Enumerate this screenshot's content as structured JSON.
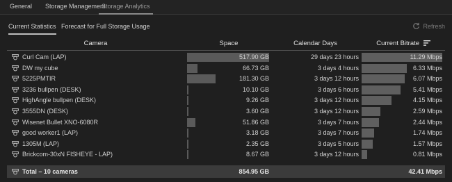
{
  "top_tabs": [
    "General",
    "Storage Management",
    "Storage Analytics"
  ],
  "sub_tabs": [
    "Current Statistics",
    "Forecast for Full Storage Usage"
  ],
  "refresh_label": "Refresh",
  "columns": {
    "camera": "Camera",
    "space": "Space",
    "days": "Calendar Days",
    "bitrate": "Current Bitrate"
  },
  "rows": [
    {
      "name": "Curl Cam (LAP)",
      "space": "517.90 GB",
      "space_fraction": 1.0,
      "days": "29 days 23 hours",
      "bitrate": "11.29 Mbps",
      "bitrate_fraction": 1.0
    },
    {
      "name": "DW my cube",
      "space": "66.73 GB",
      "space_fraction": 0.129,
      "days": "3 days 4 hours",
      "bitrate": "6.33 Mbps",
      "bitrate_fraction": 0.561
    },
    {
      "name": "5225PMTIR",
      "space": "181.30 GB",
      "space_fraction": 0.35,
      "days": "3 days 12 hours",
      "bitrate": "6.07 Mbps",
      "bitrate_fraction": 0.538
    },
    {
      "name": "3236 bullpen (DESK)",
      "space": "10.10 GB",
      "space_fraction": 0.0195,
      "days": "3 days 6 hours",
      "bitrate": "5.41 Mbps",
      "bitrate_fraction": 0.479
    },
    {
      "name": "HighAngle bullpen (DESK)",
      "space": "9.26 GB",
      "space_fraction": 0.0179,
      "days": "3 days 12 hours",
      "bitrate": "4.15 Mbps",
      "bitrate_fraction": 0.368
    },
    {
      "name": "3555DN (DESK)",
      "space": "3.60 GB",
      "space_fraction": 0.007,
      "days": "3 days 12 hours",
      "bitrate": "2.59 Mbps",
      "bitrate_fraction": 0.229
    },
    {
      "name": "Wisenet Bullet XNO-6080R",
      "space": "51.86 GB",
      "space_fraction": 0.1,
      "days": "3 days 7 hours",
      "bitrate": "2.44 Mbps",
      "bitrate_fraction": 0.216
    },
    {
      "name": "good worker1 (LAP)",
      "space": "3.18 GB",
      "space_fraction": 0.0061,
      "days": "3 days 7 hours",
      "bitrate": "1.74 Mbps",
      "bitrate_fraction": 0.154
    },
    {
      "name": "1305M (LAP)",
      "space": "2.35 GB",
      "space_fraction": 0.0045,
      "days": "3 days 5 hours",
      "bitrate": "1.57 Mbps",
      "bitrate_fraction": 0.139
    },
    {
      "name": "Brickcom-30xN FISHEYE - LAP)",
      "space": "8.67 GB",
      "space_fraction": 0.0167,
      "days": "3 days 12 hours",
      "bitrate": "0.81 Mbps",
      "bitrate_fraction": 0.072
    }
  ],
  "total": {
    "label": "Total – 10 cameras",
    "space": "854.95 GB",
    "bitrate": "42.41 Mbps"
  },
  "colors": {
    "background": "#1f1f1f",
    "bar": "#5a5a5a",
    "total_row": "#3b3b3b"
  }
}
